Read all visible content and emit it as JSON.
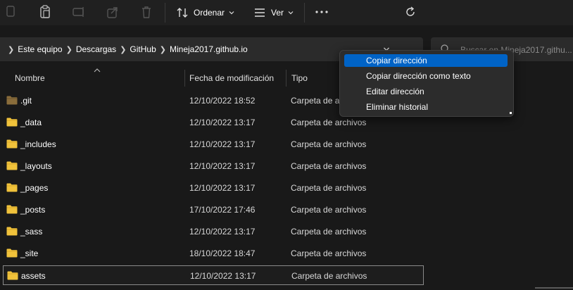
{
  "toolbar": {
    "sort_label": "Ordenar",
    "view_label": "Ver",
    "more_label": "···"
  },
  "breadcrumb": {
    "items": [
      "Este equipo",
      "Descargas",
      "GitHub",
      "Mineja2017.github.io"
    ]
  },
  "search": {
    "placeholder": "Buscar en Mineja2017.githu..."
  },
  "columns": {
    "name": "Nombre",
    "modified": "Fecha de modificación",
    "type": "Tipo"
  },
  "files": [
    {
      "name": ".git",
      "modified": "12/10/2022 18:52",
      "type": "Carpeta de archivos",
      "hidden": true
    },
    {
      "name": "_data",
      "modified": "12/10/2022 13:17",
      "type": "Carpeta de archivos"
    },
    {
      "name": "_includes",
      "modified": "12/10/2022 13:17",
      "type": "Carpeta de archivos"
    },
    {
      "name": "_layouts",
      "modified": "12/10/2022 13:17",
      "type": "Carpeta de archivos"
    },
    {
      "name": "_pages",
      "modified": "12/10/2022 13:17",
      "type": "Carpeta de archivos"
    },
    {
      "name": "_posts",
      "modified": "17/10/2022 17:46",
      "type": "Carpeta de archivos"
    },
    {
      "name": "_sass",
      "modified": "12/10/2022 13:17",
      "type": "Carpeta de archivos"
    },
    {
      "name": "_site",
      "modified": "18/10/2022 18:47",
      "type": "Carpeta de archivos"
    },
    {
      "name": "assets",
      "modified": "12/10/2022 13:17",
      "type": "Carpeta de archivos",
      "selected": true
    }
  ],
  "context_menu": {
    "items": [
      "Copiar dirección",
      "Copiar dirección como texto",
      "Editar dirección",
      "Eliminar historial"
    ],
    "active_index": 0
  },
  "colors": {
    "accent": "#0063c6",
    "folder": "#f0c23b",
    "hidden_folder": "#8a6d3b",
    "background": "#191919"
  },
  "icons": [
    "copy-icon",
    "paste-icon",
    "rename-icon",
    "share-icon",
    "delete-icon",
    "sort-icon",
    "view-icon",
    "more-icon",
    "chevron-right-icon",
    "chevron-down-icon",
    "refresh-icon",
    "search-icon",
    "folder-icon"
  ]
}
